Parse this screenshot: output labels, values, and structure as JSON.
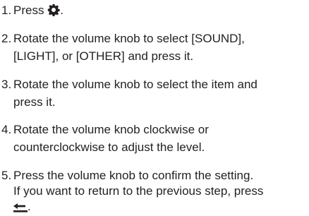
{
  "steps": [
    {
      "number": "1.",
      "parts": [
        "Press",
        "."
      ],
      "icon": "gear-icon"
    },
    {
      "number": "2.",
      "lines": [
        "Rotate the volume knob to select [SOUND],",
        "[LIGHT], or [OTHER] and press it."
      ]
    },
    {
      "number": "3.",
      "lines": [
        "Rotate the volume knob to select the item and",
        "press it."
      ]
    },
    {
      "number": "4.",
      "lines": [
        "Rotate the volume knob clockwise or",
        "counterclockwise to adjust the level."
      ]
    },
    {
      "number": "5.",
      "lines": [
        "Press the volume knob to confirm the setting."
      ]
    }
  ],
  "note": {
    "line1": "If you want to return to the previous step, press",
    "after_icon": ".",
    "icon": "back-arrow-icon"
  }
}
